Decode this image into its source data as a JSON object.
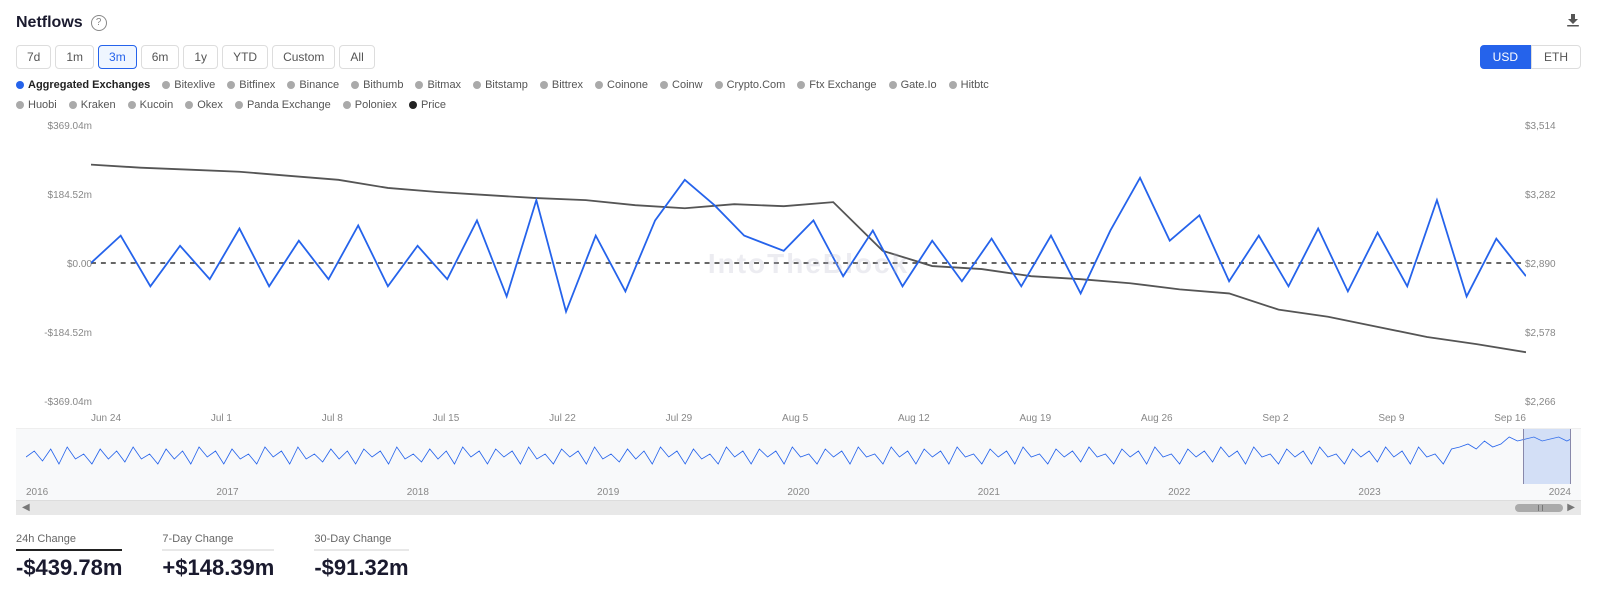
{
  "header": {
    "title": "Netflows",
    "help_icon": "?",
    "download_icon": "⬇"
  },
  "time_buttons": [
    {
      "label": "7d",
      "active": false
    },
    {
      "label": "1m",
      "active": false
    },
    {
      "label": "3m",
      "active": true
    },
    {
      "label": "6m",
      "active": false
    },
    {
      "label": "1y",
      "active": false
    },
    {
      "label": "YTD",
      "active": false
    },
    {
      "label": "Custom",
      "active": false
    },
    {
      "label": "All",
      "active": false
    }
  ],
  "currency_buttons": [
    {
      "label": "USD",
      "active": true
    },
    {
      "label": "ETH",
      "active": false
    }
  ],
  "legend": [
    {
      "label": "Aggregated Exchanges",
      "color": "#2563eb",
      "bold": true
    },
    {
      "label": "Bitexlive",
      "color": "#aaa"
    },
    {
      "label": "Bitfinex",
      "color": "#aaa"
    },
    {
      "label": "Binance",
      "color": "#aaa"
    },
    {
      "label": "Bithumb",
      "color": "#aaa"
    },
    {
      "label": "Bitmax",
      "color": "#aaa"
    },
    {
      "label": "Bitstamp",
      "color": "#aaa"
    },
    {
      "label": "Bittrex",
      "color": "#aaa"
    },
    {
      "label": "Coinone",
      "color": "#aaa"
    },
    {
      "label": "Coinw",
      "color": "#aaa"
    },
    {
      "label": "Crypto.Com",
      "color": "#aaa"
    },
    {
      "label": "Ftx Exchange",
      "color": "#aaa"
    },
    {
      "label": "Gate.Io",
      "color": "#aaa"
    },
    {
      "label": "Hitbtc",
      "color": "#aaa"
    },
    {
      "label": "Huobi",
      "color": "#aaa"
    },
    {
      "label": "Kraken",
      "color": "#aaa"
    },
    {
      "label": "Kucoin",
      "color": "#aaa"
    },
    {
      "label": "Okex",
      "color": "#aaa"
    },
    {
      "label": "Panda Exchange",
      "color": "#aaa"
    },
    {
      "label": "Poloniex",
      "color": "#aaa"
    },
    {
      "label": "Price",
      "color": "#222"
    }
  ],
  "y_axis_left": [
    "$369.04m",
    "$184.52m",
    "$0.00",
    "-$184.52m",
    "-$369.04m"
  ],
  "y_axis_right": [
    "$3,514",
    "$3,282",
    "$2,890",
    "$2,578",
    "$2,266"
  ],
  "x_axis_labels": [
    "Jun 24",
    "Jul 1",
    "Jul 8",
    "Jul 15",
    "Jul 22",
    "Jul 29",
    "Aug 5",
    "Aug 12",
    "Aug 19",
    "Aug 26",
    "Sep 2",
    "Sep 9",
    "Sep 16"
  ],
  "mini_x_axis": [
    "2016",
    "2017",
    "2018",
    "2019",
    "2020",
    "2021",
    "2022",
    "2023",
    "2024"
  ],
  "watermark": "IntoTheBlock",
  "stats": [
    {
      "label": "24h Change",
      "value": "-$439.78m",
      "type": "negative"
    },
    {
      "label": "7-Day Change",
      "value": "+$148.39m",
      "type": "positive"
    },
    {
      "label": "30-Day Change",
      "value": "-$91.32m",
      "type": "negative"
    }
  ]
}
